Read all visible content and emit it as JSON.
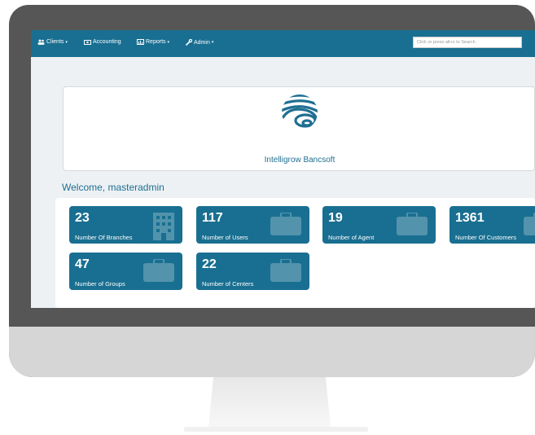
{
  "nav": {
    "clients": "Clients",
    "accounting": "Accounting",
    "reports": "Reports",
    "admin": "Admin",
    "search_placeholder": "Click or press alt+x to Search"
  },
  "brand": {
    "name": "Intelligrow Bancsoft"
  },
  "welcome": "Welcome, masteradmin",
  "stats": [
    {
      "value": "23",
      "label": "Number Of Branches",
      "icon": "building-icon"
    },
    {
      "value": "117",
      "label": "Number of Users",
      "icon": "briefcase-icon"
    },
    {
      "value": "19",
      "label": "Number of Agent",
      "icon": "briefcase-icon"
    },
    {
      "value": "1361",
      "label": "Number Of Customers",
      "icon": "briefcase-icon"
    },
    {
      "value": "47",
      "label": "Number of Groups",
      "icon": "briefcase-icon"
    },
    {
      "value": "22",
      "label": "Number of Centers",
      "icon": "briefcase-icon"
    }
  ],
  "colors": {
    "primary": "#196f91",
    "bezel": "#565656",
    "chin": "#d6d6d6",
    "screen_bg": "#edf1f4"
  }
}
